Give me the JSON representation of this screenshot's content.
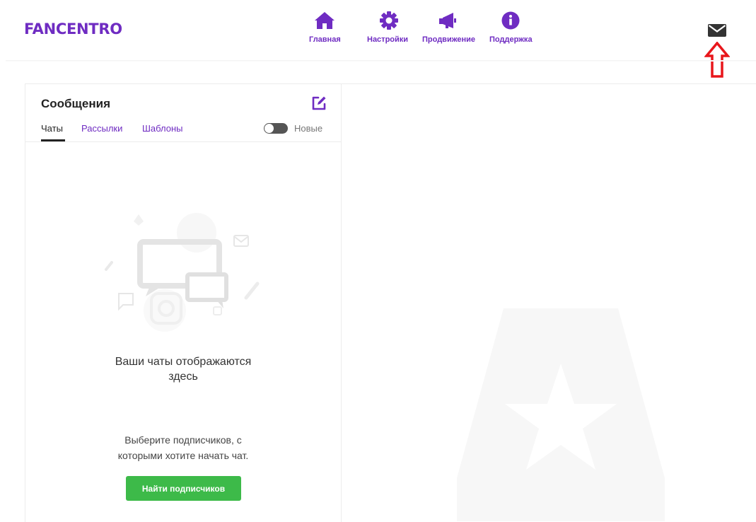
{
  "header": {
    "logo": "FANCENTRO",
    "nav": [
      {
        "label": "Главная",
        "icon": "home-icon"
      },
      {
        "label": "Настройки",
        "icon": "gear-icon"
      },
      {
        "label": "Продвижение",
        "icon": "megaphone-icon"
      },
      {
        "label": "Поддержка",
        "icon": "info-icon"
      }
    ],
    "messages_icon": "envelope-icon",
    "annotation_icon": "red-up-arrow-icon"
  },
  "messages_panel": {
    "title": "Сообщения",
    "compose_icon": "compose-edit-icon",
    "tabs": [
      {
        "label": "Чаты",
        "active": true
      },
      {
        "label": "Рассылки",
        "active": false
      },
      {
        "label": "Шаблоны",
        "active": false
      }
    ],
    "toggle": {
      "label": "Новые",
      "on": false
    },
    "empty_state": {
      "title_line1": "Ваши чаты отображаются",
      "title_line2": "здесь",
      "desc_line1": "Выберите подписчиков, с",
      "desc_line2": "которыми хотите начать чат.",
      "button_label": "Найти подписчиков"
    }
  },
  "colors": {
    "brand": "#6f2cc2",
    "button_green": "#3dba49",
    "annotation_red": "#e8161b"
  }
}
